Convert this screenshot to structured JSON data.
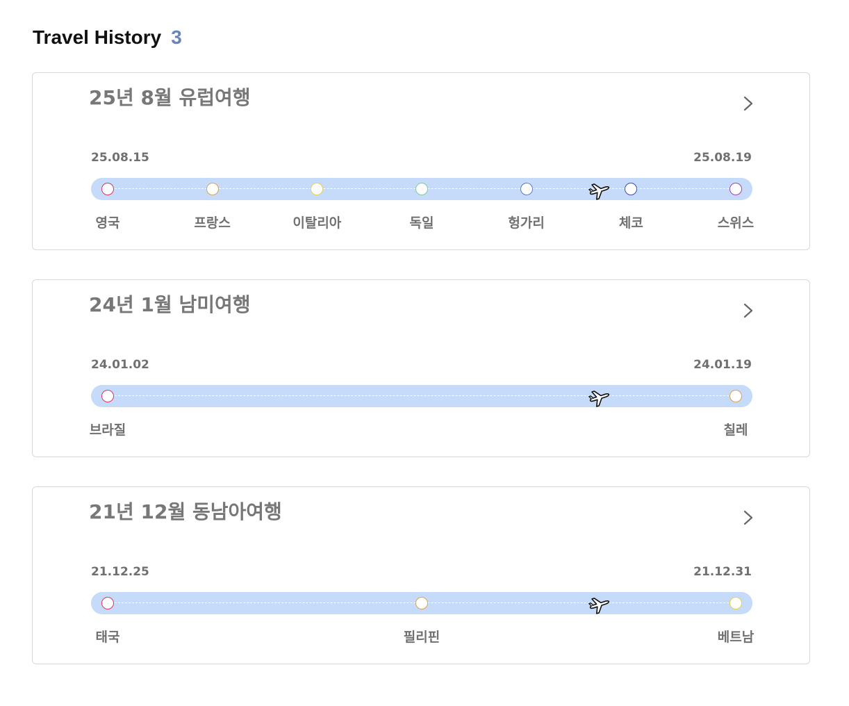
{
  "header": {
    "title": "Travel History",
    "count": "3"
  },
  "trips": [
    {
      "title": "25년 8월 유럽여행",
      "start_date": "25.08.15",
      "end_date": "25.08.19",
      "stops": [
        {
          "city": "영국",
          "color": "#d9375a"
        },
        {
          "city": "프랑스",
          "color": "#d7a451"
        },
        {
          "city": "이탈리아",
          "color": "#e6d24e"
        },
        {
          "city": "독일",
          "color": "#7ccf97"
        },
        {
          "city": "헝가리",
          "color": "#5b79c9"
        },
        {
          "city": "체코",
          "color": "#3f4bb8"
        },
        {
          "city": "스위스",
          "color": "#a73fbd"
        }
      ]
    },
    {
      "title": "24년 1월 남미여행",
      "start_date": "24.01.02",
      "end_date": "24.01.19",
      "stops": [
        {
          "city": "브라질",
          "color": "#d9375a"
        },
        {
          "city": "칠레",
          "color": "#e0a050"
        }
      ]
    },
    {
      "title": "21년 12월 동남아여행",
      "start_date": "21.12.25",
      "end_date": "21.12.31",
      "stops": [
        {
          "city": "태국",
          "color": "#d9375a"
        },
        {
          "city": "필리핀",
          "color": "#e0a050"
        },
        {
          "city": "베트남",
          "color": "#e6d24e"
        }
      ]
    }
  ],
  "icons": {
    "chevron": "chevron-right-icon",
    "plane": "airplane-icon"
  }
}
